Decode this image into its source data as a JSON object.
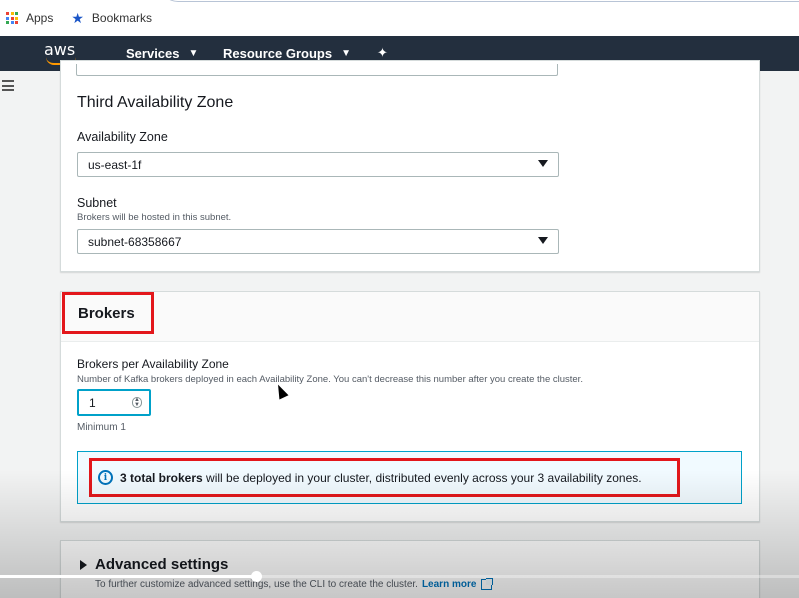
{
  "bookmarks_bar": {
    "apps_label": "Apps",
    "bookmarks_label": "Bookmarks",
    "apps_icon": "apps-grid-icon",
    "bookmarks_icon": "star-icon"
  },
  "navbar": {
    "logo_text": "aws",
    "services_label": "Services",
    "resource_groups_label": "Resource Groups",
    "pin_icon": "pushpin-icon",
    "bg_color": "#232f3e",
    "accent_color": "#ff9900"
  },
  "third_zone": {
    "title": "Third Availability Zone",
    "az_label": "Availability Zone",
    "az_value": "us-east-1f",
    "subnet_label": "Subnet",
    "subnet_desc": "Brokers will be hosted in this subnet.",
    "subnet_value": "subnet-68358667"
  },
  "brokers": {
    "title": "Brokers",
    "per_az_label": "Brokers per Availability Zone",
    "per_az_desc": "Number of Kafka brokers deployed in each Availability Zone. You can't decrease this number after you create the cluster.",
    "per_az_value": "1",
    "minimum_text": "Minimum 1",
    "info_bold": "3 total brokers",
    "info_rest": " will be deployed in your cluster, distributed evenly across your 3 availability zones."
  },
  "advanced": {
    "title": "Advanced settings",
    "desc": "To further customize advanced settings, use the CLI to create the cluster.",
    "link_text": "Learn more"
  },
  "video": {
    "progress": 0.32
  },
  "colors": {
    "highlight": "#e3171b",
    "info_border": "#00a1c9",
    "link": "#0073bb"
  }
}
